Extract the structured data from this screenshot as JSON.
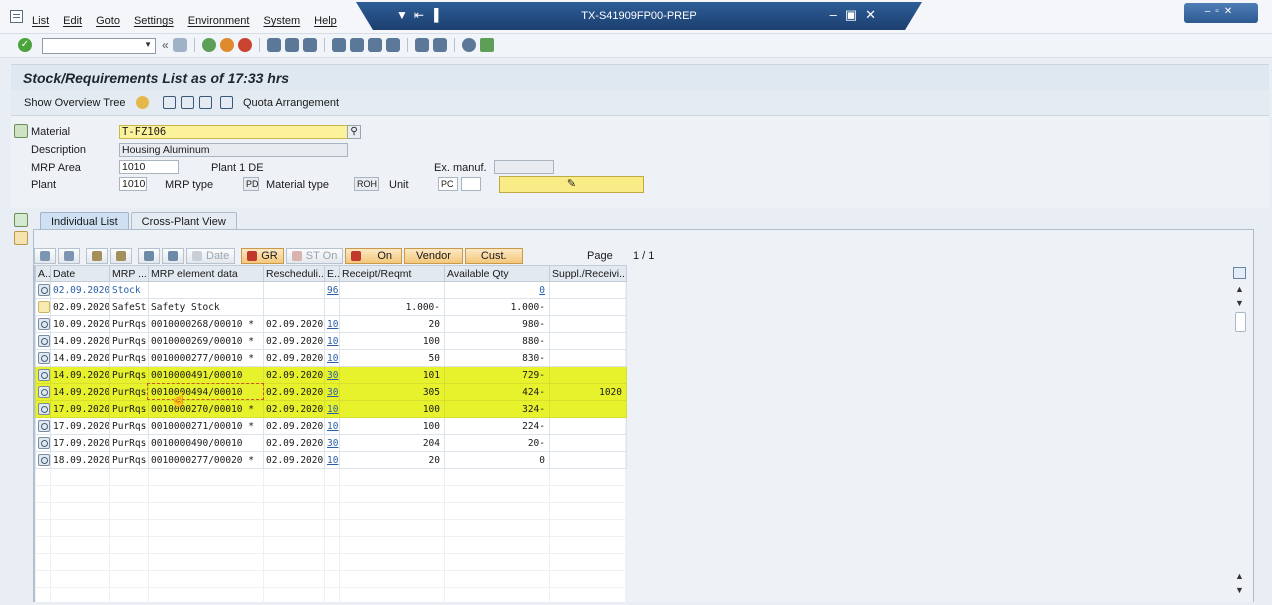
{
  "menu": {
    "items": [
      "List",
      "Edit",
      "Goto",
      "Settings",
      "Environment",
      "System",
      "Help"
    ]
  },
  "window": {
    "system_title": "TX-S41909FP00-PREP"
  },
  "header": {
    "title": "Stock/Requirements List as of 17:33 hrs"
  },
  "app_toolbar": {
    "show_overview_tree": "Show Overview Tree",
    "quota_arrangement": "Quota Arrangement"
  },
  "fields": {
    "material_label": "Material",
    "material_value": "T-FZ106",
    "description_label": "Description",
    "description_value": "Housing Aluminum",
    "mrp_area_label": "MRP Area",
    "mrp_area_value": "1010",
    "mrp_area_text": "Plant 1 DE",
    "ex_manuf_label": "Ex. manuf.",
    "ex_manuf_value": "",
    "plant_label": "Plant",
    "plant_value": "1010",
    "mrp_type_label": "MRP type",
    "mrp_type_value": "PD",
    "material_type_label": "Material type",
    "material_type_value": "ROH",
    "unit_label": "Unit",
    "unit_value": "PC",
    "unit_value2": ""
  },
  "tabs": [
    {
      "label": "Individual List",
      "active": true
    },
    {
      "label": "Cross-Plant View",
      "active": false
    }
  ],
  "grid_toolbar": {
    "date_btn": "Date",
    "gr_btn": "GR",
    "st_on_btn": "ST On",
    "on_btn": "On",
    "vendor_btn": "Vendor",
    "cust_btn": "Cust.",
    "page_label": "Page",
    "page_value": "1  /  1"
  },
  "table": {
    "columns": [
      "A..",
      "Date",
      "MRP ...",
      "MRP element data",
      "Rescheduli...",
      "E..",
      "Receipt/Reqmt",
      "Available Qty",
      "Suppl./Receivi..."
    ],
    "rows": [
      {
        "date": "02.09.2020",
        "mrp": "Stock",
        "data": "",
        "resched": "",
        "e": "96",
        "receipt": "",
        "avail": "0",
        "suppl": "",
        "icon": "detail",
        "blue": true,
        "hl": false
      },
      {
        "date": "02.09.2020",
        "mrp": "SafeSt",
        "data": "Safety Stock",
        "resched": "",
        "e": "",
        "receipt": "1.000-",
        "avail": "1.000-",
        "suppl": "",
        "icon": "blank",
        "blue": false,
        "hl": false
      },
      {
        "date": "10.09.2020",
        "mrp": "PurRqs",
        "data": "0010000268/00010 *",
        "resched": "02.09.2020",
        "e": "10",
        "receipt": "20",
        "avail": "980-",
        "suppl": "",
        "icon": "detail",
        "blue": false,
        "hl": false
      },
      {
        "date": "14.09.2020",
        "mrp": "PurRqs",
        "data": "0010000269/00010 *",
        "resched": "02.09.2020",
        "e": "10",
        "receipt": "100",
        "avail": "880-",
        "suppl": "",
        "icon": "detail",
        "blue": false,
        "hl": false
      },
      {
        "date": "14.09.2020",
        "mrp": "PurRqs",
        "data": "0010000277/00010 *",
        "resched": "02.09.2020",
        "e": "10",
        "receipt": "50",
        "avail": "830-",
        "suppl": "",
        "icon": "detail",
        "blue": false,
        "hl": false
      },
      {
        "date": "14.09.2020",
        "mrp": "PurRqs",
        "data": "0010000491/00010",
        "resched": "02.09.2020",
        "e": "30",
        "receipt": "101",
        "avail": "729-",
        "suppl": "",
        "icon": "detail",
        "blue": false,
        "hl": true
      },
      {
        "date": "14.09.2020",
        "mrp": "PurRqs",
        "data": "0010000494/00010",
        "resched": "02.09.2020",
        "e": "30",
        "receipt": "305",
        "avail": "424-",
        "suppl": "1020",
        "icon": "detail",
        "blue": false,
        "hl": true
      },
      {
        "date": "17.09.2020",
        "mrp": "PurRqs",
        "data": "0010000270/00010 *",
        "resched": "02.09.2020",
        "e": "10",
        "receipt": "100",
        "avail": "324-",
        "suppl": "",
        "icon": "detail",
        "blue": false,
        "hl": true
      },
      {
        "date": "17.09.2020",
        "mrp": "PurRqs",
        "data": "0010000271/00010 *",
        "resched": "02.09.2020",
        "e": "10",
        "receipt": "100",
        "avail": "224-",
        "suppl": "",
        "icon": "detail",
        "blue": false,
        "hl": false
      },
      {
        "date": "17.09.2020",
        "mrp": "PurRqs",
        "data": "0010000490/00010",
        "resched": "02.09.2020",
        "e": "30",
        "receipt": "204",
        "avail": "20-",
        "suppl": "",
        "icon": "detail",
        "blue": false,
        "hl": false
      },
      {
        "date": "18.09.2020",
        "mrp": "PurRqs",
        "data": "0010000277/00020 *",
        "resched": "02.09.2020",
        "e": "10",
        "receipt": "20",
        "avail": "0",
        "suppl": "",
        "icon": "detail",
        "blue": false,
        "hl": false
      }
    ]
  },
  "colors": {
    "highlight": "#e8f22c",
    "title_bar": "#1c3f6f",
    "yellow_field": "#fbf29b"
  }
}
